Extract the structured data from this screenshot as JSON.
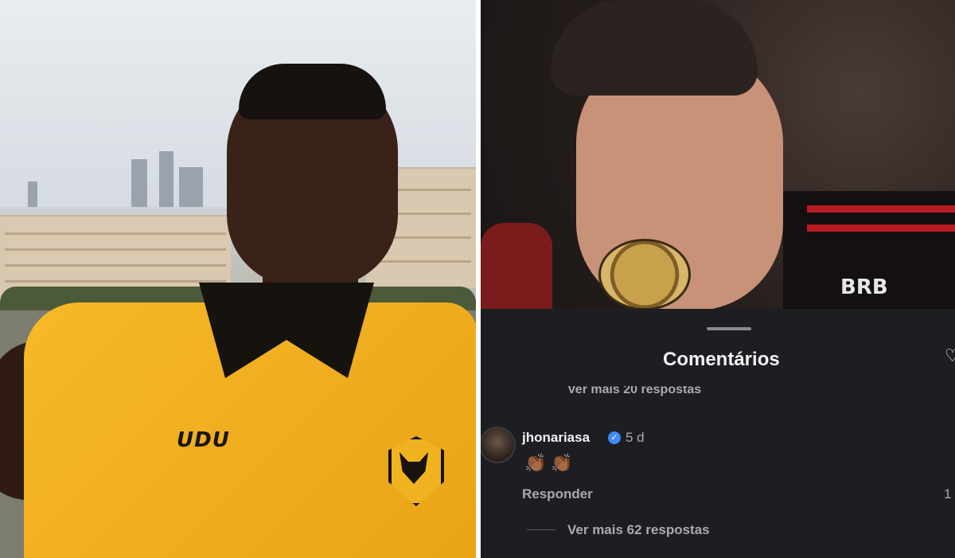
{
  "left_photo": {
    "sponsor_text": "UDU",
    "crest": "wolf-crest-icon"
  },
  "right_photo": {
    "sponsor_text": "BRB"
  },
  "comments": {
    "title": "Comentários",
    "more_replies_top": "Ver mais 20 respostas",
    "comment": {
      "username": "jhonariasa",
      "verified": true,
      "time": "5 d",
      "text": "👏🏾👏🏾",
      "reply_label": "Responder",
      "like_count": "1"
    },
    "more_replies_bottom": "Ver mais 62 respostas"
  },
  "colors": {
    "sheet_background": "#1d1e22",
    "verified_badge": "#3d8bfd",
    "jersey_gold": "#f6b928"
  }
}
